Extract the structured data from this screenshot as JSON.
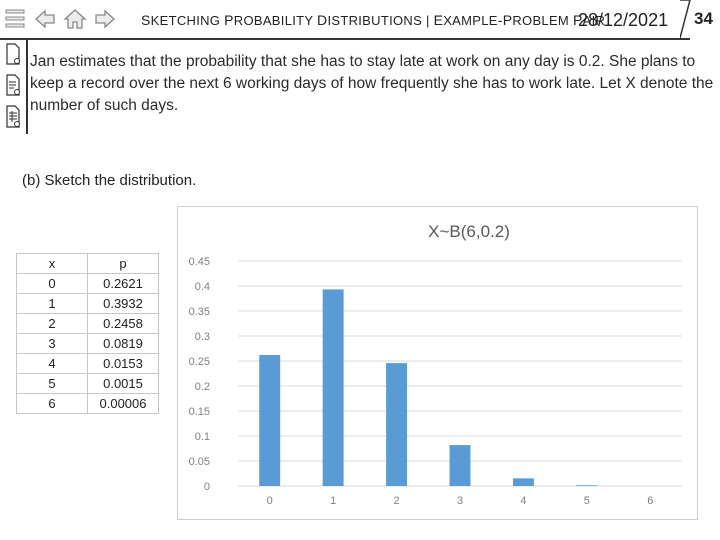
{
  "header": {
    "title_parts": [
      "S",
      "KETCHING ",
      "P",
      "ROBABILITY ",
      "D",
      "ISTRIBUTIONS | ",
      "E",
      "XAMPLE",
      "-P",
      "ROBLEM ",
      "P",
      "AIR"
    ],
    "date": "28/12/2021",
    "page_number": "34"
  },
  "icons": [
    "menu-icon",
    "back-arrow-icon",
    "home-icon",
    "forward-arrow-icon",
    "blank-document-icon",
    "notes-document-icon",
    "worksheet-document-icon"
  ],
  "problem": {
    "intro": "Jan estimates that the probability that she has to stay late at work on any day is 0.2. She plans to keep a record over the next 6 working days of how frequently she has to work late. Let X denote the number of such days.",
    "part_b": "(b) Sketch the distribution."
  },
  "table": {
    "headers": [
      "x",
      "p"
    ],
    "rows": [
      [
        "0",
        "0.2621"
      ],
      [
        "1",
        "0.3932"
      ],
      [
        "2",
        "0.2458"
      ],
      [
        "3",
        "0.0819"
      ],
      [
        "4",
        "0.0153"
      ],
      [
        "5",
        "0.0015"
      ],
      [
        "6",
        "0.00006"
      ]
    ]
  },
  "chart_data": {
    "type": "bar",
    "title": "X~B(6,0.2)",
    "categories": [
      "0",
      "1",
      "2",
      "3",
      "4",
      "5",
      "6"
    ],
    "values": [
      0.2621,
      0.3932,
      0.2458,
      0.0819,
      0.0153,
      0.0015,
      6e-05
    ],
    "ylim": [
      0,
      0.45
    ],
    "yticks": [
      "0",
      "0.05",
      "0.1",
      "0.15",
      "0.2",
      "0.25",
      "0.3",
      "0.35",
      "0.4",
      "0.45"
    ],
    "grid": true,
    "bar_color": "#5b9bd5"
  }
}
